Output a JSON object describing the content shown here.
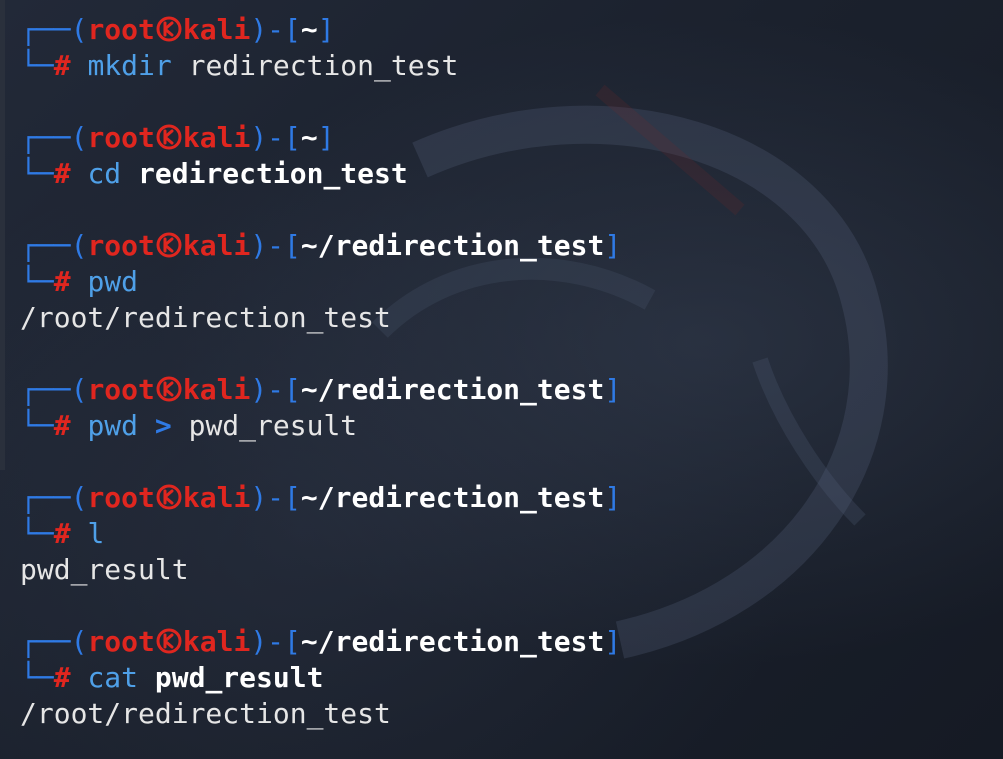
{
  "prompt": {
    "user": "root",
    "host": "kali",
    "hash": "#",
    "box_top": "┌──(",
    "box_mid": ")-[",
    "box_end": "]",
    "box_bottom": "└─"
  },
  "entries": [
    {
      "dir": "~",
      "cmd": "mkdir",
      "args": [
        {
          "text": "redirection_test",
          "style": "plain"
        }
      ],
      "output": ""
    },
    {
      "dir": "~",
      "cmd": "cd",
      "args": [
        {
          "text": "redirection_test",
          "style": "bold"
        }
      ],
      "output": ""
    },
    {
      "dir": "~/redirection_test",
      "cmd": "pwd",
      "args": [],
      "output": "/root/redirection_test"
    },
    {
      "dir": "~/redirection_test",
      "cmd": "pwd",
      "args": [
        {
          "text": ">",
          "style": "op"
        },
        {
          "text": "pwd_result",
          "style": "plain"
        }
      ],
      "output": ""
    },
    {
      "dir": "~/redirection_test",
      "cmd": "l",
      "args": [],
      "output": "pwd_result"
    },
    {
      "dir": "~/redirection_test",
      "cmd": "cat",
      "args": [
        {
          "text": "pwd_result",
          "style": "bold"
        }
      ],
      "output": "/root/redirection_test"
    }
  ],
  "colors": {
    "background": "#1a1f2b",
    "prompt_frame": "#2f7ae5",
    "prompt_user_host": "#e0261f",
    "command": "#4fa0e8",
    "text": "#e6e6e6"
  },
  "icons": {
    "separator": "kali-skull-icon"
  }
}
